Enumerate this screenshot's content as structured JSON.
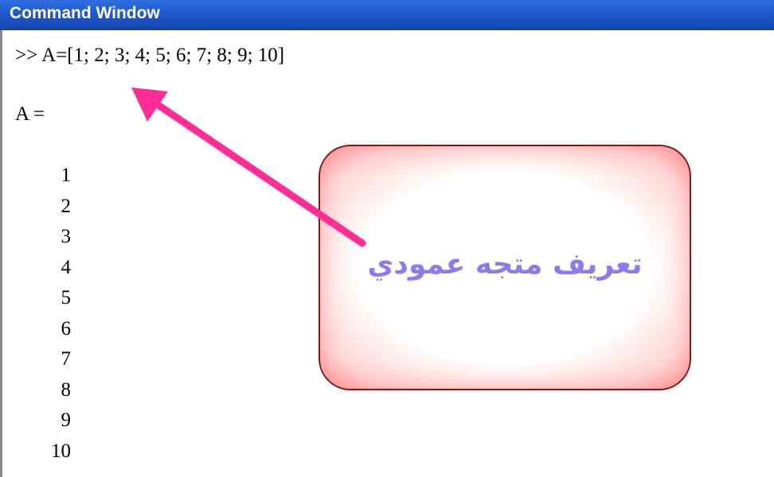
{
  "window": {
    "title": "Command Window"
  },
  "console": {
    "command": ">> A=[1; 2; 3; 4; 5; 6; 7; 8; 9; 10]",
    "result_label": "A =",
    "values": [
      "1",
      "2",
      "3",
      "4",
      "5",
      "6",
      "7",
      "8",
      "9",
      "10"
    ]
  },
  "annotation": {
    "text": "تعريف متجه عمودي",
    "arrow_color": "#ff2d95",
    "box_border_color": "#7f1a1a",
    "text_color": "#8a7cf0"
  }
}
